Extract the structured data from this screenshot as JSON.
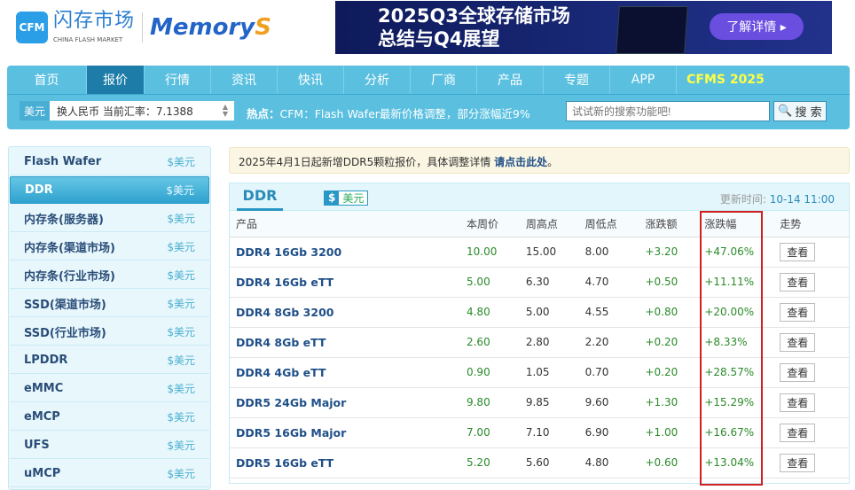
{
  "header": {
    "logo_badge": "CFM",
    "logo_cn": "闪存市场",
    "logo_en": "CHINA FLASH MARKET",
    "logo_memorys": "Memory",
    "logo_memorys_s": "S",
    "banner": {
      "line1": "2025Q3全球存储市场",
      "line2": "总结与Q4展望",
      "button": "了解详情 ▸"
    }
  },
  "nav": {
    "items": [
      "首页",
      "报价",
      "行情",
      "资讯",
      "快讯",
      "分析",
      "厂商",
      "产品",
      "专题",
      "APP",
      "CFMS 2025"
    ],
    "active": 1
  },
  "toolbar": {
    "currency": "美元",
    "rate": "换人民币 当前汇率：7.1388",
    "hot_label": "热点：",
    "hot_text": "CFM：Flash Wafer最新价格调整，部分涨幅近9%",
    "search_placeholder": "试试新的搜索功能吧!",
    "search_button": "搜 索"
  },
  "sidebar": {
    "items": [
      {
        "label": "Flash Wafer",
        "cur": "$美元"
      },
      {
        "label": "DDR",
        "cur": "$美元"
      },
      {
        "label": "内存条(服务器)",
        "cur": "$美元"
      },
      {
        "label": "内存条(渠道市场)",
        "cur": "$美元"
      },
      {
        "label": "内存条(行业市场)",
        "cur": "$美元"
      },
      {
        "label": "SSD(渠道市场)",
        "cur": "$美元"
      },
      {
        "label": "SSD(行业市场)",
        "cur": "$美元"
      },
      {
        "label": "LPDDR",
        "cur": "$美元"
      },
      {
        "label": "eMMC",
        "cur": "$美元"
      },
      {
        "label": "eMCP",
        "cur": "$美元"
      },
      {
        "label": "UFS",
        "cur": "$美元"
      },
      {
        "label": "uMCP",
        "cur": "$美元"
      }
    ],
    "active": 1
  },
  "notice": {
    "text": "2025年4月1日起新增DDR5颗粒报价，具体调整详情 ",
    "link": "请点击此处",
    "end": "。"
  },
  "panel": {
    "tab": "DDR",
    "currency_symbol": "$",
    "currency": "美元",
    "update_label": "更新时间:",
    "update_time": " 10-14 11:00",
    "columns": [
      "产品",
      "本周价",
      "周高点",
      "周低点",
      "涨跌额",
      "涨跌幅",
      "走势"
    ],
    "rows": [
      [
        "DDR4 16Gb 3200",
        "10.00",
        "15.00",
        "8.00",
        "+3.20",
        "+47.06%",
        "查看"
      ],
      [
        "DDR4 16Gb eTT",
        "5.00",
        "6.30",
        "4.70",
        "+0.50",
        "+11.11%",
        "查看"
      ],
      [
        "DDR4 8Gb 3200",
        "4.80",
        "5.00",
        "4.55",
        "+0.80",
        "+20.00%",
        "查看"
      ],
      [
        "DDR4 8Gb eTT",
        "2.60",
        "2.80",
        "2.20",
        "+0.20",
        "+8.33%",
        "查看"
      ],
      [
        "DDR4 4Gb eTT",
        "0.90",
        "1.05",
        "0.70",
        "+0.20",
        "+28.57%",
        "查看"
      ],
      [
        "DDR5 24Gb Major",
        "9.80",
        "9.85",
        "9.60",
        "+1.30",
        "+15.29%",
        "查看"
      ],
      [
        "DDR5 16Gb Major",
        "7.00",
        "7.10",
        "6.90",
        "+1.00",
        "+16.67%",
        "查看"
      ],
      [
        "DDR5 16Gb eTT",
        "5.20",
        "5.60",
        "4.80",
        "+0.60",
        "+13.04%",
        "查看"
      ]
    ]
  },
  "colors": {
    "nav": "#5bc0e0",
    "active": "#1d7da8",
    "up": "#2a8a2a",
    "highlight": "#d02020"
  }
}
